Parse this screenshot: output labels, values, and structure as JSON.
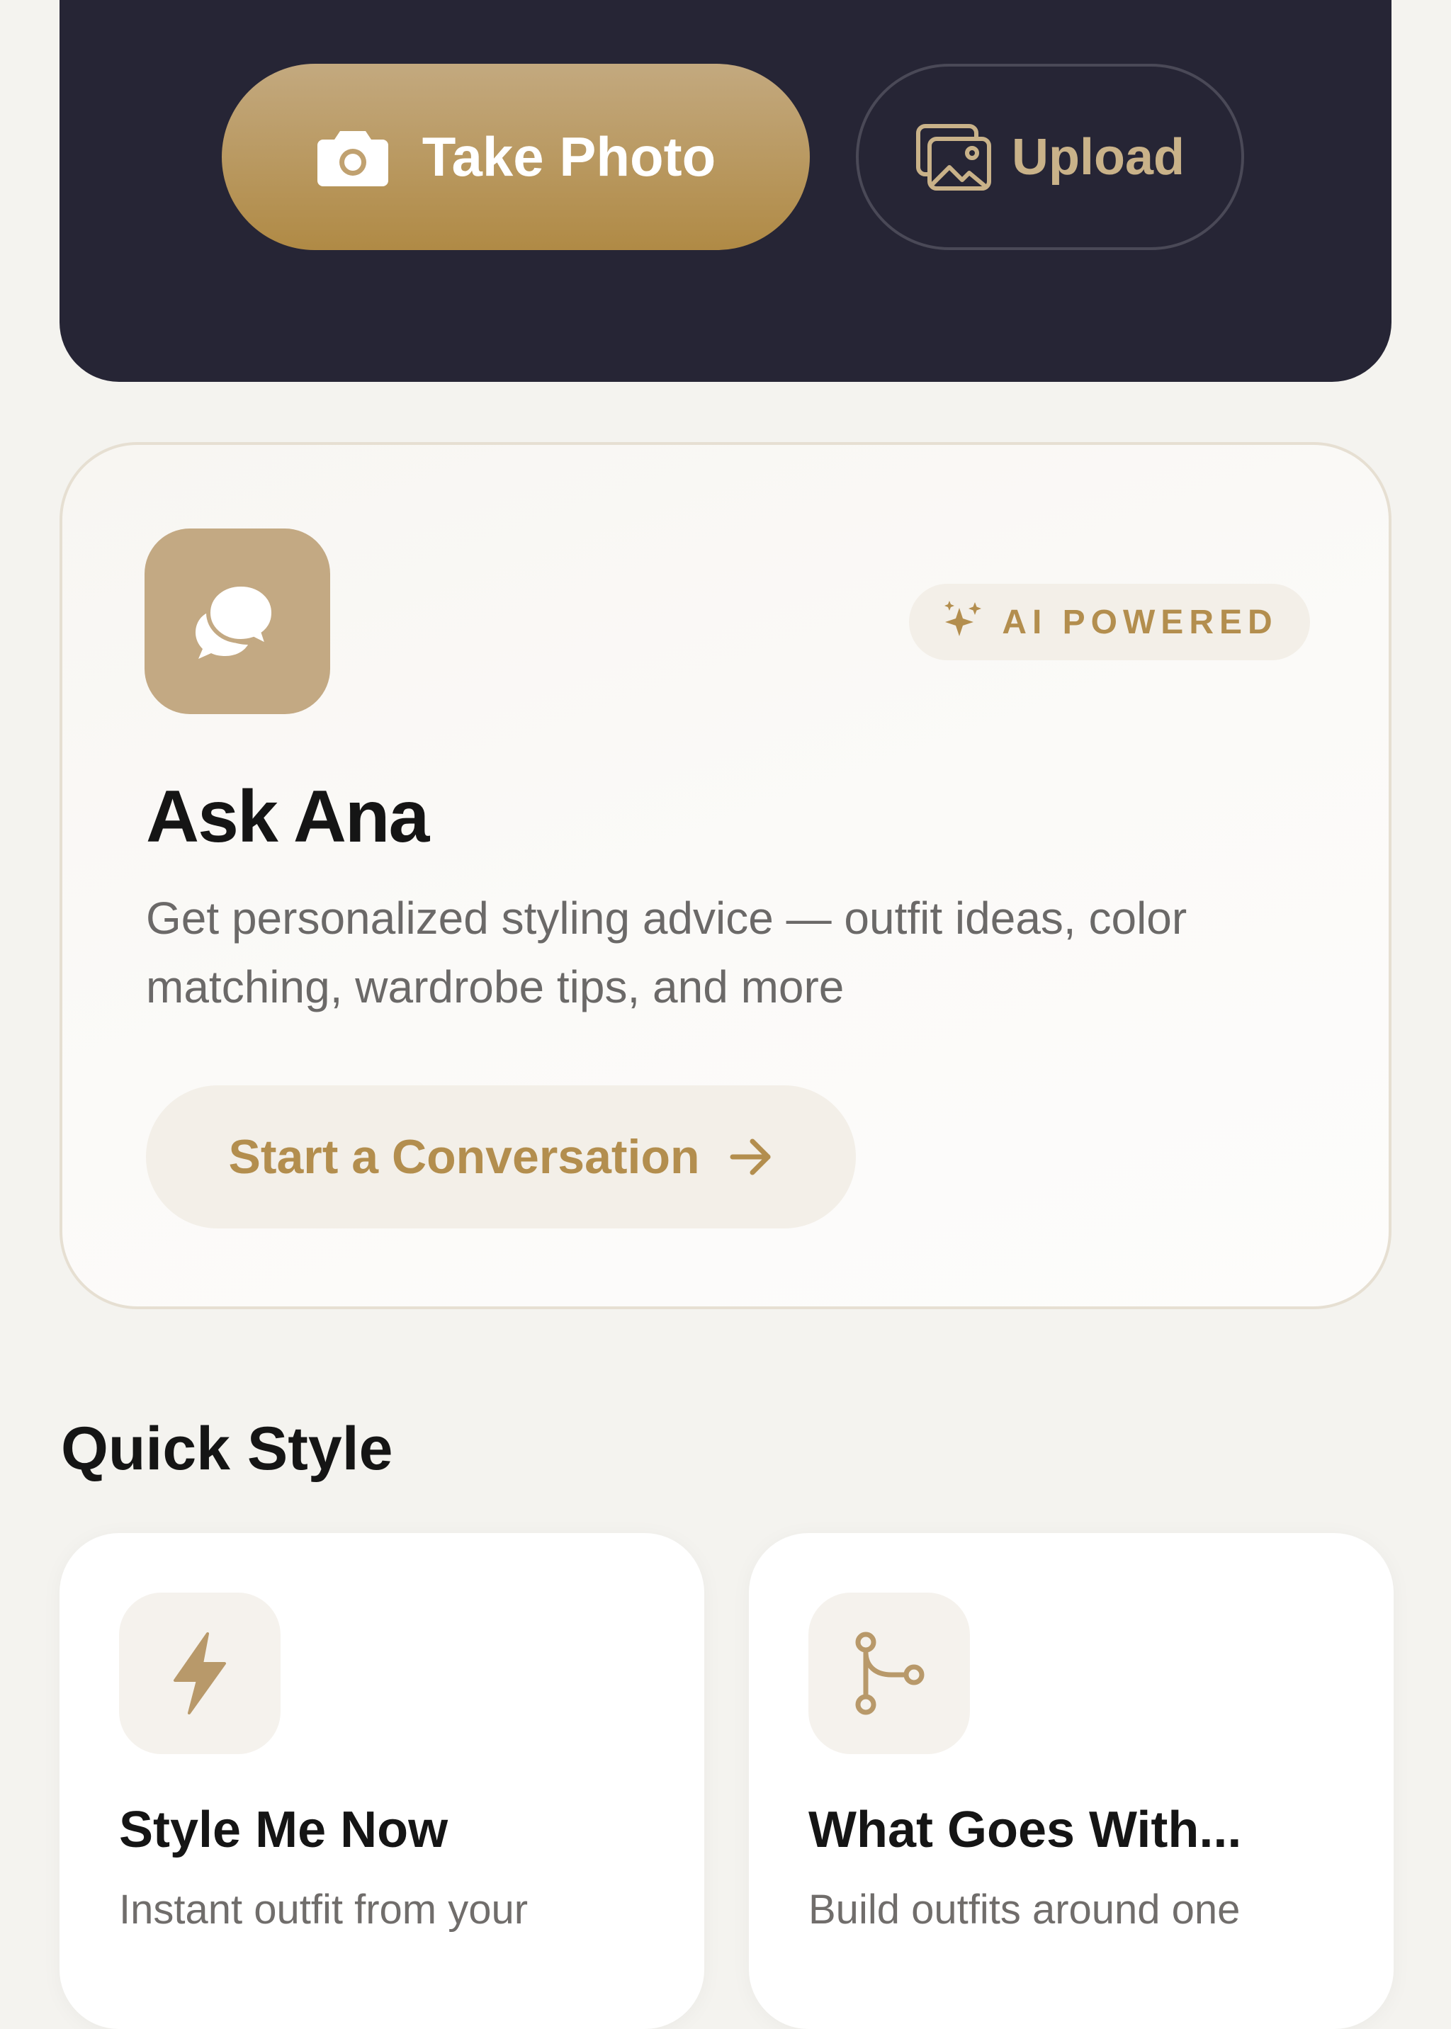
{
  "hero": {
    "take_photo_label": "Take Photo",
    "upload_label": "Upload"
  },
  "ask_ana": {
    "badge": "AI POWERED",
    "title": "Ask Ana",
    "description": "Get personalized styling advice — outfit ideas, color matching, wardrobe tips, and more",
    "cta_label": "Start a Conversation"
  },
  "quick_style": {
    "section_title": "Quick Style",
    "cards": [
      {
        "title": "Style Me Now",
        "description": "Instant outfit from your",
        "icon": "lightning-icon"
      },
      {
        "title": "What Goes With...",
        "description": "Build outfits around one",
        "icon": "branch-icon"
      }
    ]
  },
  "colors": {
    "accent_gold": "#b38e4e",
    "hero_dark": "#262535",
    "background": "#f4f3ef"
  }
}
